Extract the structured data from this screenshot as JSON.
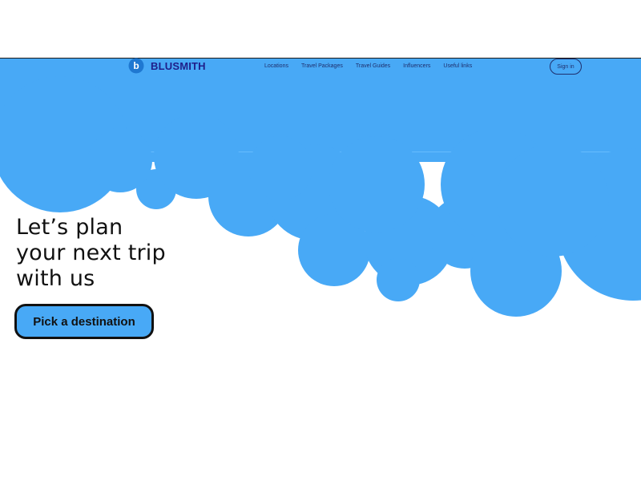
{
  "theme": {
    "hero_color": "#48a9f6",
    "brand_color": "#1f1f8a",
    "nav_text_color": "#1f2f6d",
    "headline_color": "#111111"
  },
  "navbar": {
    "brand_name": "BLUSMITH",
    "brand_icon": "b-circle-logo-icon",
    "links": [
      "Locations",
      "Travel Packages",
      "Travel Guides",
      "Influencers",
      "Useful links"
    ],
    "signin_label": "Sign in"
  },
  "hero": {
    "headline_lines": [
      "Let’s plan",
      "your next trip",
      "with us"
    ],
    "cta_label": "Pick a destination"
  }
}
